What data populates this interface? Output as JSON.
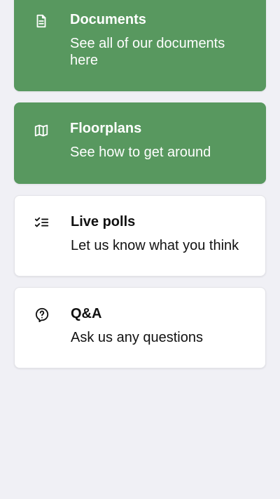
{
  "colors": {
    "background": "#f0f0f5",
    "accent_green": "#58985f",
    "card_white": "#ffffff"
  },
  "items": [
    {
      "title": "Documents",
      "subtitle": "See all of our documents here",
      "icon": "document-icon",
      "style": "green"
    },
    {
      "title": "Floorplans",
      "subtitle": "See how to get around",
      "icon": "map-icon",
      "style": "green"
    },
    {
      "title": "Live polls",
      "subtitle": "Let us know what you think",
      "icon": "checklist-icon",
      "style": "white"
    },
    {
      "title": "Q&A",
      "subtitle": "Ask us any questions",
      "icon": "question-bubble-icon",
      "style": "white"
    }
  ]
}
